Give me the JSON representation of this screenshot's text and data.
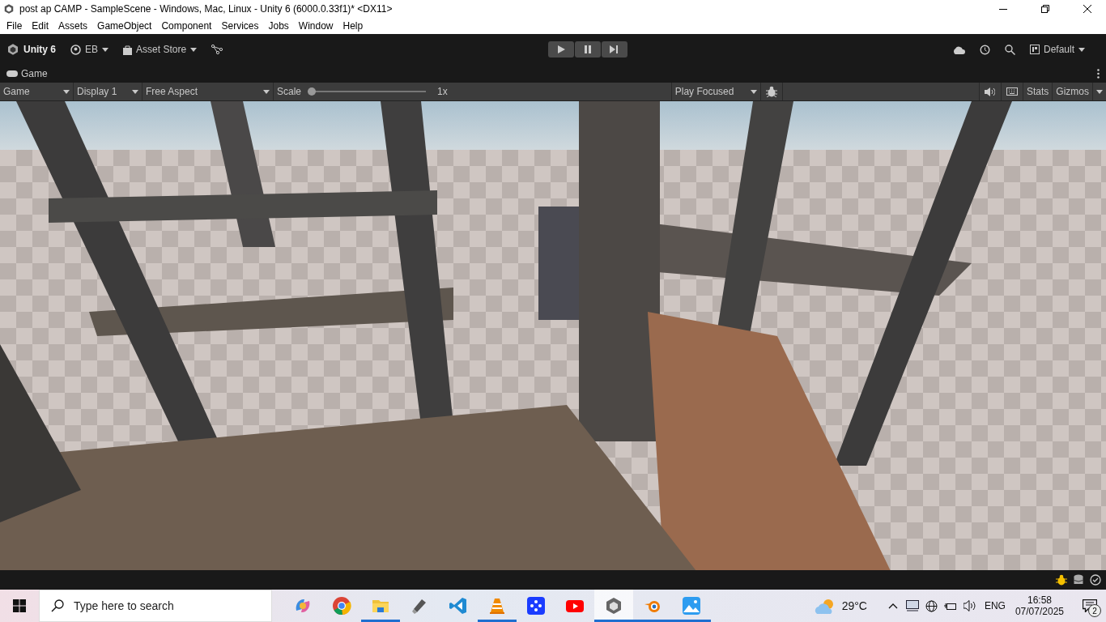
{
  "window": {
    "title": "post ap CAMP - SampleScene - Windows, Mac, Linux - Unity 6 (6000.0.33f1)* <DX11>"
  },
  "menu": [
    "File",
    "Edit",
    "Assets",
    "GameObject",
    "Component",
    "Services",
    "Jobs",
    "Window",
    "Help"
  ],
  "toolbar": {
    "product": "Unity 6",
    "account": "EB",
    "asset_store": "Asset Store",
    "layout": "Default"
  },
  "play_controls": [
    {
      "kind": "play",
      "selected": false
    },
    {
      "kind": "pause",
      "selected": false
    },
    {
      "kind": "step",
      "selected": false
    }
  ],
  "tab": {
    "label": "Game"
  },
  "game_toolbar": {
    "view": "Game",
    "display": "Display 1",
    "aspect": "Free Aspect",
    "scale_label": "Scale",
    "scale": {
      "level": 0.0
    },
    "scale_reading": "1x",
    "play_mode": "Play Focused",
    "stats": "Stats",
    "gizmos": "Gizmos"
  },
  "taskbar": {
    "search_placeholder": "Type here to search",
    "apps": [
      {
        "kind": "copilot",
        "running": false,
        "selected": false
      },
      {
        "kind": "chrome",
        "running": false,
        "selected": false
      },
      {
        "kind": "folder",
        "running": true,
        "selected": false
      },
      {
        "kind": "usb",
        "running": false,
        "selected": false
      },
      {
        "kind": "code",
        "running": false,
        "selected": false
      },
      {
        "kind": "cone",
        "running": true,
        "selected": false
      },
      {
        "kind": "dots",
        "running": false,
        "selected": false
      },
      {
        "kind": "video",
        "running": false,
        "selected": false
      },
      {
        "kind": "cube",
        "running": true,
        "selected": true
      },
      {
        "kind": "blender",
        "running": true,
        "selected": false
      },
      {
        "kind": "photos",
        "running": true,
        "selected": false
      }
    ],
    "temperature": "29°C",
    "language": "ENG",
    "time": "16:58",
    "date": "07/07/2025",
    "notifications": "2"
  }
}
